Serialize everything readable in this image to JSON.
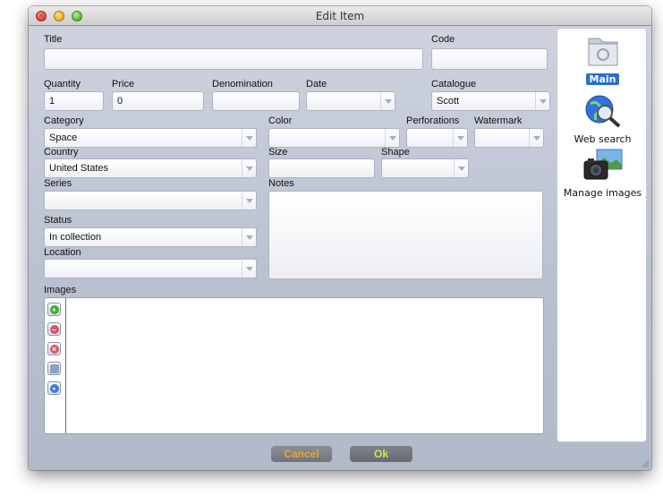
{
  "window": {
    "title": "Edit Item"
  },
  "form": {
    "title": {
      "label": "Title",
      "value": ""
    },
    "code": {
      "label": "Code",
      "value": ""
    },
    "quantity": {
      "label": "Quantity",
      "value": "1"
    },
    "price": {
      "label": "Price",
      "value": "0"
    },
    "denomination": {
      "label": "Denomination",
      "value": ""
    },
    "date": {
      "label": "Date",
      "value": ""
    },
    "catalogue": {
      "label": "Catalogue",
      "value": "Scott"
    },
    "category": {
      "label": "Category",
      "value": "Space"
    },
    "color": {
      "label": "Color",
      "value": ""
    },
    "perforations": {
      "label": "Perforations",
      "value": ""
    },
    "watermark": {
      "label": "Watermark",
      "value": ""
    },
    "country": {
      "label": "Country",
      "value": "United States"
    },
    "size": {
      "label": "Size",
      "value": ""
    },
    "shape": {
      "label": "Shape",
      "value": ""
    },
    "series": {
      "label": "Series",
      "value": ""
    },
    "notes": {
      "label": "Notes",
      "value": ""
    },
    "status": {
      "label": "Status",
      "value": "In collection"
    },
    "location": {
      "label": "Location",
      "value": ""
    },
    "images": {
      "label": "Images"
    }
  },
  "image_tools": [
    {
      "icon": "add-icon"
    },
    {
      "icon": "remove-icon"
    },
    {
      "icon": "delete-icon"
    },
    {
      "icon": "edit-icon"
    },
    {
      "icon": "info-icon"
    }
  ],
  "side_panel": {
    "items": [
      {
        "label": "Main",
        "icon": "folder-icon",
        "selected": true
      },
      {
        "label": "Web search",
        "icon": "globe-search-icon",
        "selected": false
      },
      {
        "label": "Manage images",
        "icon": "camera-icon",
        "selected": false
      }
    ]
  },
  "buttons": {
    "cancel": "Cancel",
    "ok": "Ok"
  },
  "colors": {
    "selection": "#2b6cd6",
    "cancel_text": "#e8a33c",
    "ok_text": "#c9e85a",
    "window_bg": "#bcc3d1"
  }
}
